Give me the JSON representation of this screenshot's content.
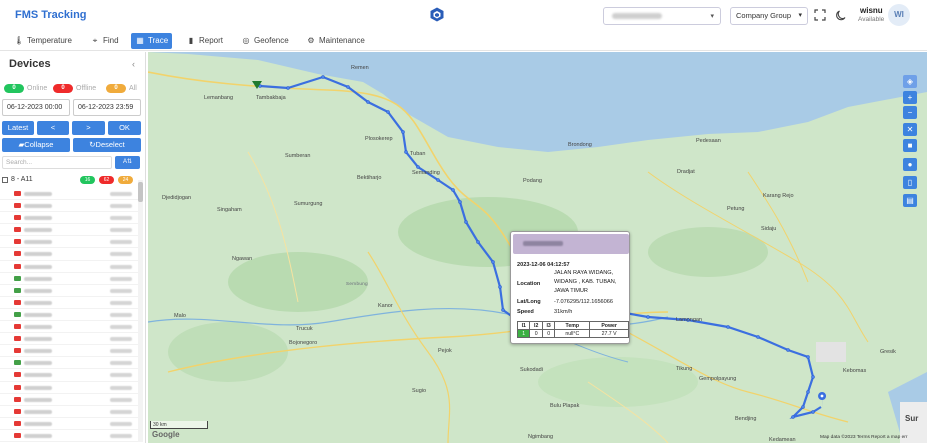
{
  "header": {
    "title": "FMS Tracking",
    "company_select": "Company Group",
    "user_name": "wisnu",
    "user_status": "Available",
    "avatar_initials": "WI"
  },
  "nav": {
    "items": [
      {
        "label": "Temperature",
        "icon": "thermometer-icon"
      },
      {
        "label": "Find",
        "icon": "location-pin-icon"
      },
      {
        "label": "Trace",
        "icon": "map-icon",
        "active": true
      },
      {
        "label": "Report",
        "icon": "bar-chart-icon"
      },
      {
        "label": "Geofence",
        "icon": "globe-icon"
      },
      {
        "label": "Maintenance",
        "icon": "gear-icon"
      }
    ]
  },
  "sidebar": {
    "title": "Devices",
    "online_count": "0",
    "online_label": "Online",
    "offline_count": "0",
    "offline_label": "Offline",
    "all_count": "0",
    "all_label": "All",
    "date_from": "06-12-2023 00:00",
    "date_to": "06-12-2023 23:59",
    "btn_latest": "Latest",
    "btn_prev": "<",
    "btn_next": ">",
    "btn_ok": "OK",
    "btn_collapse": "Collapse",
    "btn_deselect": "Deselect",
    "search_placeholder": "Search...",
    "sort_label": "A",
    "group_name": "8 - A11",
    "group_badges": [
      "16",
      "62",
      "24"
    ],
    "vehicle_status_colors": [
      "#e53935",
      "#e53935",
      "#e53935",
      "#e53935",
      "#e53935",
      "#e53935",
      "#e53935",
      "#43a047",
      "#43a047",
      "#e53935",
      "#43a047",
      "#e53935",
      "#e53935",
      "#e53935",
      "#43a047",
      "#e53935",
      "#e53935",
      "#e53935",
      "#e53935",
      "#e53935",
      "#e53935",
      "#e53935"
    ]
  },
  "popup": {
    "datetime": "2023-12-06 04:12:57",
    "location_label": "Location",
    "location_value_1": "JALAN RAYA WIDANG,",
    "location_value_2": "WIDANG , KAB. TUBAN,",
    "location_value_3": "JAWA TIMUR",
    "latlong_label": "Lat/Long",
    "latlong_value": "-7.076295/112.1656066",
    "speed_label": "Speed",
    "speed_value": "31km/h",
    "table_headers": [
      "I1",
      "I2",
      "I3",
      "Temp",
      "Power"
    ],
    "table_row": [
      "1",
      "0",
      "0",
      "null°C",
      "27.7 V"
    ]
  },
  "map": {
    "places": [
      "Remen",
      "Lemanbang",
      "Tambakbaja",
      "Plosokerep",
      "Tuban",
      "Semanding",
      "Brondong",
      "Pedesaan",
      "Podang",
      "Dradjat",
      "Djedidjogan",
      "Singaham",
      "Sumurgung",
      "Bektiharjo",
      "Karang Rejo",
      "Petung",
      "Sidaju",
      "Ngawan",
      "Sumberan",
      "Sembung",
      "Kanor",
      "Malo",
      "Trucuk",
      "Bojonegoro",
      "Pejok",
      "Lamongan",
      "Gresik",
      "Kebomas",
      "Tikung",
      "Gempolpayung",
      "Sukodadi",
      "Bulu Plapak",
      "Ngimbang",
      "Bendjing",
      "Sugio",
      "Kedamean",
      "Sur"
    ],
    "scale_label": "30 km",
    "google_label": "Google",
    "attribution": "Map data ©2023    Terms    Report a map err",
    "colors": {
      "water": "#a9cbe6",
      "land": "#cfe6c9",
      "route": "#3b6fe0",
      "road": "#f2d36b"
    }
  }
}
